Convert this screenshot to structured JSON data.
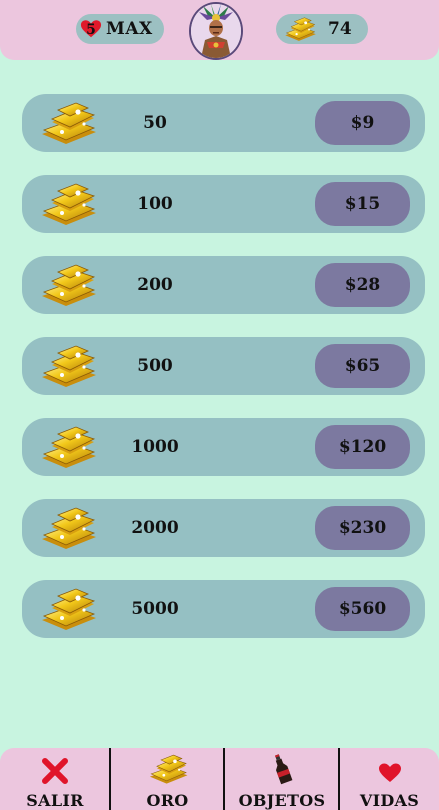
{
  "header": {
    "lives_count": "5",
    "lives_label": "MAX",
    "gold_count": "74"
  },
  "packs": [
    {
      "amount": "50",
      "price": "$9"
    },
    {
      "amount": "100",
      "price": "$15"
    },
    {
      "amount": "200",
      "price": "$28"
    },
    {
      "amount": "500",
      "price": "$65"
    },
    {
      "amount": "1000",
      "price": "$120"
    },
    {
      "amount": "2000",
      "price": "$230"
    },
    {
      "amount": "5000",
      "price": "$560"
    }
  ],
  "nav": {
    "salir": "SALIR",
    "oro": "ORO",
    "objetos": "OBJETOS",
    "vidas": "VIDAS"
  },
  "colors": {
    "background": "#c8f4e0",
    "panel": "#ecc6de",
    "row": "#95c0c3",
    "price_button": "#7c79a0",
    "heart": "#e01a2a"
  }
}
